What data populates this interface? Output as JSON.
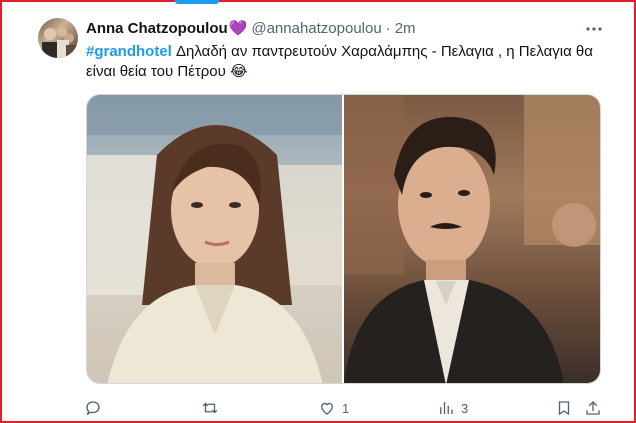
{
  "tweet": {
    "author": "Anna Chatzopoulou",
    "author_badge": "💜",
    "handle": "@annahatzopoulou",
    "separator": "·",
    "time": "2m",
    "hashtag": "#grandhotel",
    "text_line1": " Δηλαδή αν παντρευτούν Χαραλάμπης - Πελαγια , η Πελαγια θα",
    "text_line2": "είναι θεία του Πέτρου 😂"
  },
  "actions": {
    "reply_count": "",
    "retweet_count": "",
    "like_count": "1",
    "views_count": "3"
  },
  "colors": {
    "accent": "#1d9bf0",
    "text": "#0f1419",
    "muted": "#536471",
    "frame": "#e0202a"
  },
  "icons": [
    "more-icon",
    "reply-icon",
    "retweet-icon",
    "like-icon",
    "views-icon",
    "bookmark-icon",
    "share-icon"
  ]
}
